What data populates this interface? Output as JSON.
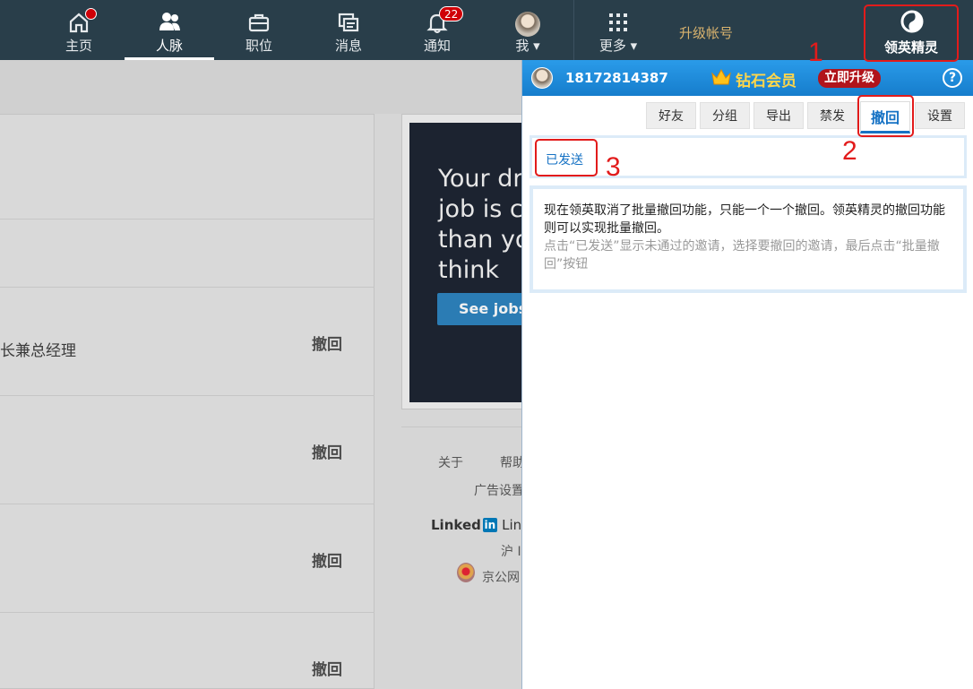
{
  "nav": {
    "items": [
      {
        "label": "主页",
        "icon": "home-icon"
      },
      {
        "label": "人脉",
        "icon": "people-icon"
      },
      {
        "label": "职位",
        "icon": "briefcase-icon"
      },
      {
        "label": "消息",
        "icon": "messages-icon"
      },
      {
        "label": "通知",
        "icon": "bell-icon",
        "badge": "22"
      },
      {
        "label": "我 ▾",
        "icon": "avatar"
      },
      {
        "label": "更多 ▾",
        "icon": "grid-icon"
      }
    ],
    "upgrade_label": "升级帐号",
    "extension_label": "领英精灵"
  },
  "background": {
    "rows": [
      {
        "text": "长兼总经理",
        "action": "撤回"
      },
      {
        "text": "",
        "action": "撤回"
      },
      {
        "text": "",
        "action": "撤回"
      },
      {
        "text": "",
        "action": "撤回"
      }
    ],
    "ad": {
      "lines": [
        "Your dre",
        "job is clo",
        "than yo",
        "think"
      ],
      "button": "See jobs"
    },
    "footer": {
      "about": "关于",
      "help": "帮助",
      "ad_settings": "广告设置",
      "linkedin_word": "Linked",
      "linkedin_in": "in",
      "linkedin_rest": "Link",
      "hu": "沪 I",
      "jinggong": "京公网"
    }
  },
  "panel": {
    "phone": "18172814387",
    "tier": "钻石会员",
    "upgrade": "立即升级",
    "help": "?",
    "tabs": [
      "好友",
      "分组",
      "导出",
      "禁发",
      "撤回",
      "设置"
    ],
    "active_tab": "撤回",
    "sent_link": "已发送",
    "info_main": "现在领英取消了批量撤回功能，只能一个一个撤回。领英精灵的撤回功能则可以实现批量撤回。",
    "info_sub": "点击“已发送”显示未通过的邀请，选择要撤回的邀请，最后点击“批量撤回”按钮"
  },
  "annotations": [
    "1",
    "2",
    "3"
  ],
  "colors": {
    "nav_bg": "#293e4a",
    "panel_blue": "#1f8fde",
    "annotation_red": "#e21b1b",
    "gold": "#ffd64a"
  }
}
